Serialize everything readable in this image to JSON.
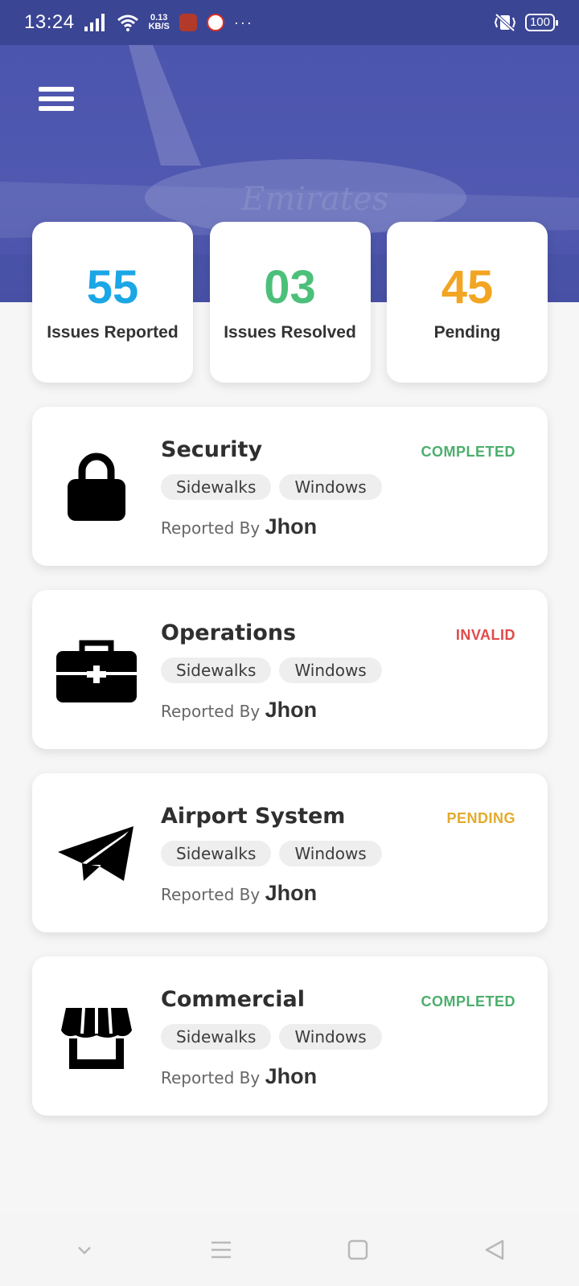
{
  "status_bar": {
    "time": "13:24",
    "net_speed_value": "0.13",
    "net_speed_unit": "KB/S",
    "battery": "100",
    "icons": [
      "signal-icon",
      "wifi-icon",
      "app-icon",
      "gmail-icon",
      "more-icon",
      "vibrate-icon",
      "battery-icon"
    ]
  },
  "hero": {
    "background_text": "Emirates",
    "menu_icon": "hamburger-menu-icon"
  },
  "stats": [
    {
      "value": "55",
      "label": "Issues Reported",
      "color": "#1ba6e6"
    },
    {
      "value": "03",
      "label": "Issues Resolved",
      "color": "#4cc07a"
    },
    {
      "value": "45",
      "label": "Pending",
      "color": "#f2a523"
    }
  ],
  "issues": [
    {
      "title": "Security",
      "status": "COMPLETED",
      "status_color": "#4cae6c",
      "icon": "lock-icon",
      "tags": [
        "Sidewalks",
        "Windows"
      ],
      "reported_prefix": "Reported By",
      "reporter": "Jhon"
    },
    {
      "title": "Operations",
      "status": "INVALID",
      "status_color": "#e04a4a",
      "icon": "toolbox-icon",
      "tags": [
        "Sidewalks",
        "Windows"
      ],
      "reported_prefix": "Reported By",
      "reporter": "Jhon"
    },
    {
      "title": "Airport System",
      "status": "PENDING",
      "status_color": "#e3ab2c",
      "icon": "paper-plane-icon",
      "tags": [
        "Sidewalks",
        "Windows"
      ],
      "reported_prefix": "Reported By",
      "reporter": "Jhon"
    },
    {
      "title": "Commercial",
      "status": "COMPLETED",
      "status_color": "#4cae6c",
      "icon": "store-icon",
      "tags": [
        "Sidewalks",
        "Windows"
      ],
      "reported_prefix": "Reported By",
      "reporter": "Jhon"
    }
  ],
  "bottom_nav": {
    "icons": [
      "chevron-down-icon",
      "menu-lines-icon",
      "home-square-icon",
      "back-triangle-icon"
    ]
  }
}
